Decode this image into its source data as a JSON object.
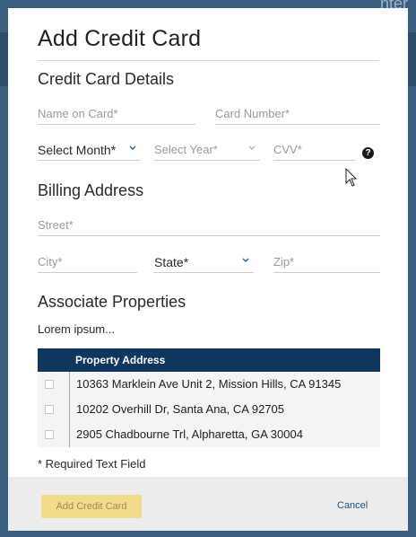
{
  "backdrop": {
    "partial_text": "nter"
  },
  "modal": {
    "title": "Add Credit Card",
    "sections": {
      "card_details": "Credit Card Details",
      "billing": "Billing Address",
      "properties": "Associate Properties"
    },
    "fields": {
      "name_on_card": {
        "placeholder": "Name on Card*"
      },
      "card_number": {
        "placeholder": "Card Number*"
      },
      "month": {
        "value": "Select Month*"
      },
      "year": {
        "placeholder": "Select Year*"
      },
      "cvv": {
        "placeholder": "CVV*"
      },
      "street": {
        "placeholder": "Street*"
      },
      "city": {
        "placeholder": "City*"
      },
      "state": {
        "value": "State*"
      },
      "zip": {
        "placeholder": "Zip*"
      }
    },
    "lorem": "Lorem ipsum...",
    "table": {
      "header": "Property Address",
      "rows": [
        {
          "address": "10363 Marklein Ave Unit 2, Mission Hills, CA 91345"
        },
        {
          "address": "10202 Overhill Dr, Santa Ana, CA 92705"
        },
        {
          "address": "2905 Chadbourne Trl, Alpharetta, GA 30004"
        }
      ]
    },
    "required_note": "* Required Text Field",
    "buttons": {
      "add": "Add Credit Card",
      "cancel": "Cancel"
    },
    "icons": [
      "help-icon",
      "chevron-down-icon",
      "mouse-cursor-icon"
    ]
  }
}
